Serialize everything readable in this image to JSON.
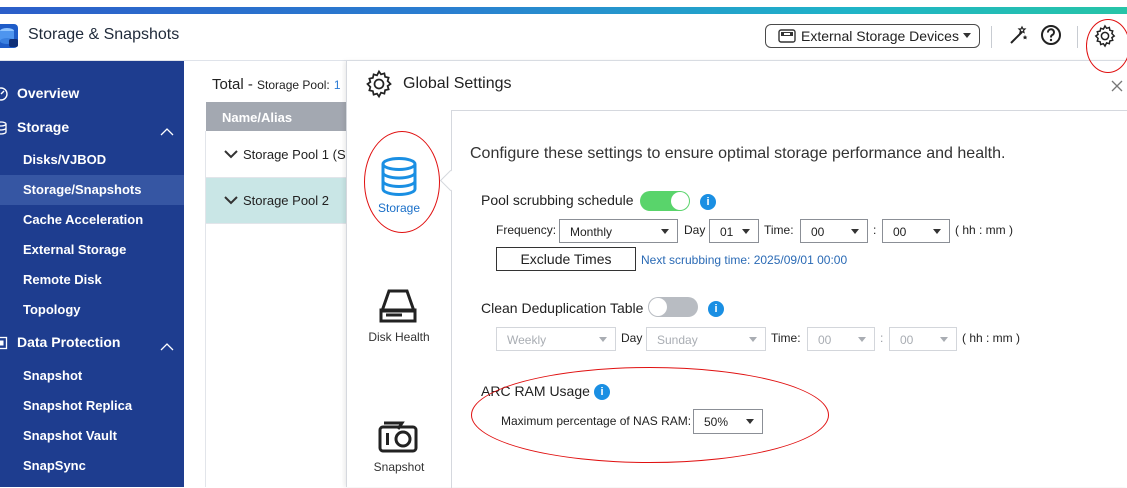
{
  "app": {
    "title": "Storage & Snapshots"
  },
  "header": {
    "external_devices_label": "External Storage Devices",
    "icons": [
      "storage-device-icon",
      "magic-wand-icon",
      "help-icon",
      "settings-gear-icon"
    ]
  },
  "sidebar": {
    "overview": "Overview",
    "storage_group": "Storage",
    "storage_items": [
      "Disks/VJBOD",
      "Storage/Snapshots",
      "Cache Acceleration",
      "External Storage",
      "Remote Disk",
      "Topology"
    ],
    "selected": "Storage/Snapshots",
    "data_protection_group": "Data Protection",
    "dp_items": [
      "Snapshot",
      "Snapshot Replica",
      "Snapshot Vault",
      "SnapSync"
    ]
  },
  "main": {
    "title": "Total -",
    "subtitle": "Storage Pool:",
    "subtitle_link": "1",
    "column_header": "Name/Alias",
    "rows": [
      "Storage Pool 1 (S",
      "Storage Pool 2"
    ]
  },
  "dialog": {
    "title": "Global Settings",
    "nav": [
      "Storage",
      "Disk Health",
      "Snapshot"
    ],
    "intro": "Configure these settings to ensure optimal storage performance and health.",
    "scrub": {
      "title": "Pool scrubbing schedule",
      "enabled": true,
      "frequency_label": "Frequency:",
      "frequency": "Monthly",
      "day_label": "Day",
      "day": "01",
      "time_label": "Time:",
      "hour": "00",
      "colon": ":",
      "minute": "00",
      "format": "( hh : mm )",
      "exclude_button": "Exclude Times",
      "next_time": "Next scrubbing time: 2025/09/01 00:00"
    },
    "dedup": {
      "title": "Clean Deduplication Table",
      "enabled": false,
      "frequency": "Weekly",
      "day_label": "Day",
      "day": "Sunday",
      "time_label": "Time:",
      "hour": "00",
      "colon": ":",
      "minute": "00",
      "format": "( hh : mm )"
    },
    "arc": {
      "title": "ARC RAM Usage",
      "max_label": "Maximum percentage of NAS RAM:",
      "value": "50%"
    }
  },
  "colors": {
    "sidebar": "#1e3d8f",
    "accent": "#1a8fe3",
    "toggle_on": "#59d46b",
    "highlight_row": "#c9e6e6",
    "annotation": "#e01010"
  }
}
